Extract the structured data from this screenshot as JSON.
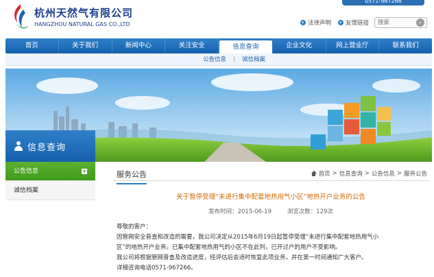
{
  "header": {
    "brand_cn": "杭州天然气有限公司",
    "brand_en": "HANGZHOU NATURAL GAS CO.,LTD",
    "hotline": "0571-967266",
    "links": [
      {
        "label": "法律声明",
        "icon": "arrow-right-icon"
      },
      {
        "label": "友情链接",
        "icon": "arrow-right-icon"
      }
    ],
    "search": {
      "placeholder": "搜索",
      "icon": "search-icon"
    }
  },
  "colors": {
    "brand_blue": "#1a5fa8",
    "nav_blue": "#2f80c9",
    "active_green": "#4ca324",
    "title_orange": "#d06a00"
  },
  "nav": {
    "items": [
      {
        "label": "首页"
      },
      {
        "label": "关于我们"
      },
      {
        "label": "新闻中心"
      },
      {
        "label": "关注安全"
      },
      {
        "label": "信息查询",
        "active": true
      },
      {
        "label": "企业文化"
      },
      {
        "label": "网上营业厅"
      },
      {
        "label": "联系我们"
      }
    ]
  },
  "subnav": {
    "items": [
      "公告信息",
      "诚信档案"
    ],
    "separator": "|"
  },
  "sidebar": {
    "title": "信息查询",
    "icon": "user-icon",
    "items": [
      {
        "label": "公告信息",
        "active": true,
        "icon": "plus-icon"
      },
      {
        "label": "诚信档案",
        "active": false
      }
    ]
  },
  "content": {
    "section_title": "服务公告",
    "breadcrumb": [
      "首页",
      "信息查询",
      "公告信息",
      "服务公告"
    ],
    "breadcrumb_sep": ">",
    "article_title": "关于暂停受理“未进行集中配套地热用气小区”地热开户业务的公告",
    "publish_time": "发布时间：2015-06-19",
    "views": "浏览次数：129次",
    "body": [
      "尊敬的客户：",
      "因管网安全普查和改造的需要，我公司决定从2015年6月19日起暂停受理“未进行集中配套地热用气小",
      "区”的地热开户业务。已集中配套地热用气的小区不在此列，已开过户的用户不受影响。",
      "我公司将根据管网普查及改造进度，经评估后会适时恢复此项业务，并在第一时间通知广大客户。",
      "详细咨询电话0571-967266。"
    ]
  }
}
